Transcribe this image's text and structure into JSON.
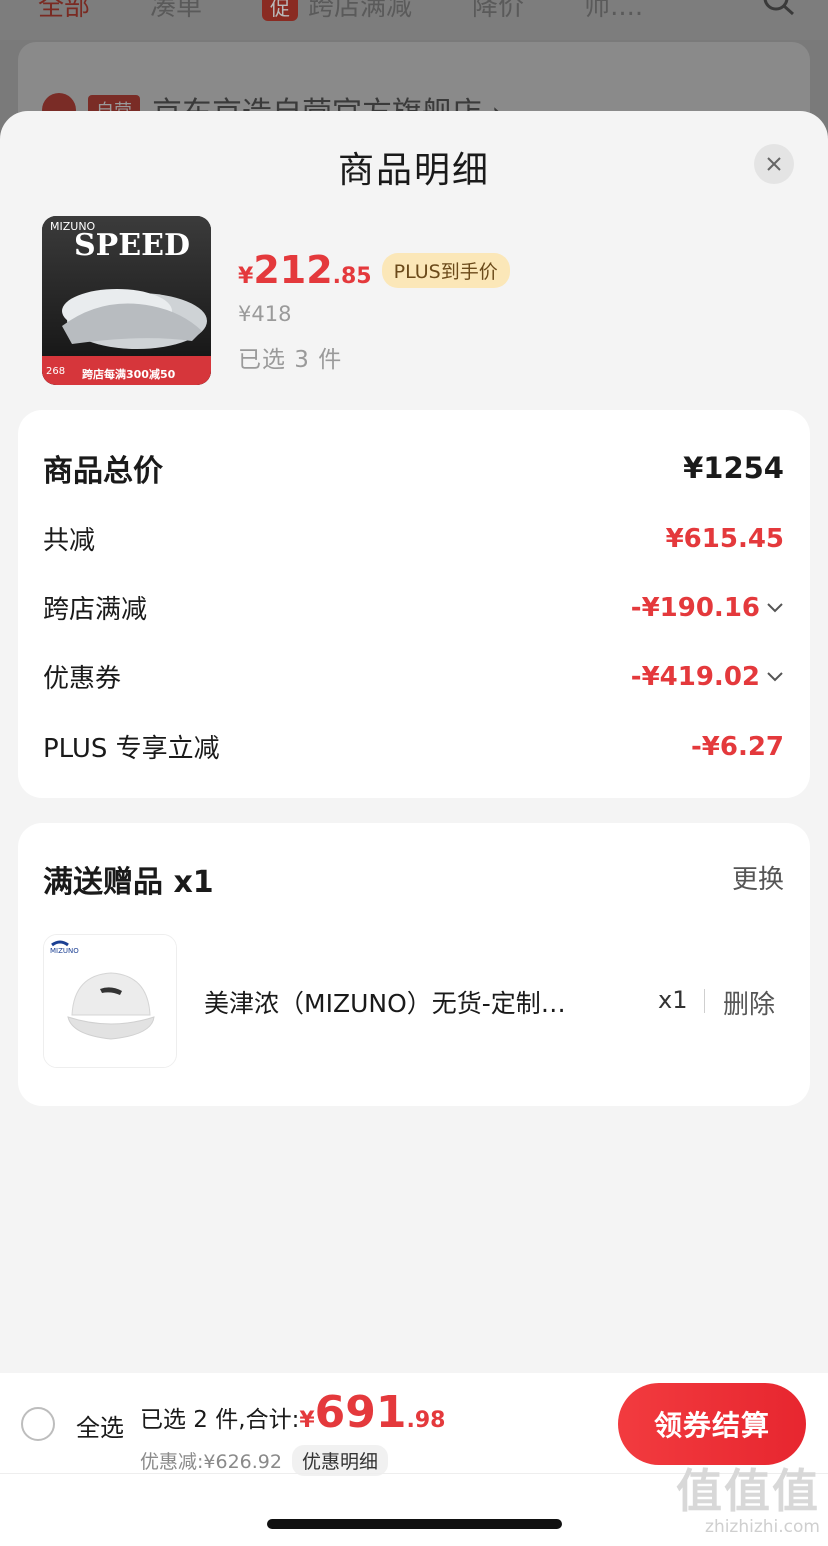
{
  "background": {
    "tabs": [
      "全部",
      "凑单",
      "跨店满减",
      "降价",
      "师...."
    ],
    "promo_tag": "促",
    "store": {
      "self_tag": "自营",
      "name": "京东京造自营官方旗舰店 ›"
    }
  },
  "sheet": {
    "title": "商品明细",
    "product": {
      "thumb_text": "SPEED",
      "thumb_brand": "MIZUNO",
      "thumb_banner": "跨店每满300减50",
      "thumb_price": "268",
      "price_symbol": "¥",
      "price_int": "212",
      "price_dec": ".85",
      "plus_tag": "PLUS到手价",
      "original_price": "¥418",
      "selected": "已选 3 件"
    },
    "price_detail": {
      "total_label": "商品总价",
      "total_value": "¥1254",
      "reduce_label": "共减",
      "reduce_value": "¥615.45",
      "cross_store_label": "跨店满减",
      "cross_store_value": "-¥190.16",
      "coupon_label": "优惠券",
      "coupon_value": "-¥419.02",
      "plus_label": "PLUS 专享立减",
      "plus_value": "-¥6.27"
    },
    "gift": {
      "title": "满送赠品 x1",
      "change": "更换",
      "thumb_brand": "MIZUNO",
      "name": "美津浓（MIZUNO）无货-定制…",
      "qty": "x1",
      "delete": "删除"
    }
  },
  "bottom_bar": {
    "select_all": "全选",
    "total_prefix": "已选 2 件,合计:",
    "total_symbol": "¥",
    "total_int": "691",
    "total_dec": ".98",
    "discount": "优惠减:¥626.92",
    "discount_detail": "优惠明细",
    "checkout": "领券结算",
    "watermark": "值值值",
    "watermark_url": "zhizhizhi.com"
  },
  "colors": {
    "accent": "#e4393c",
    "plus_tag_bg": "#fbe7b8"
  }
}
